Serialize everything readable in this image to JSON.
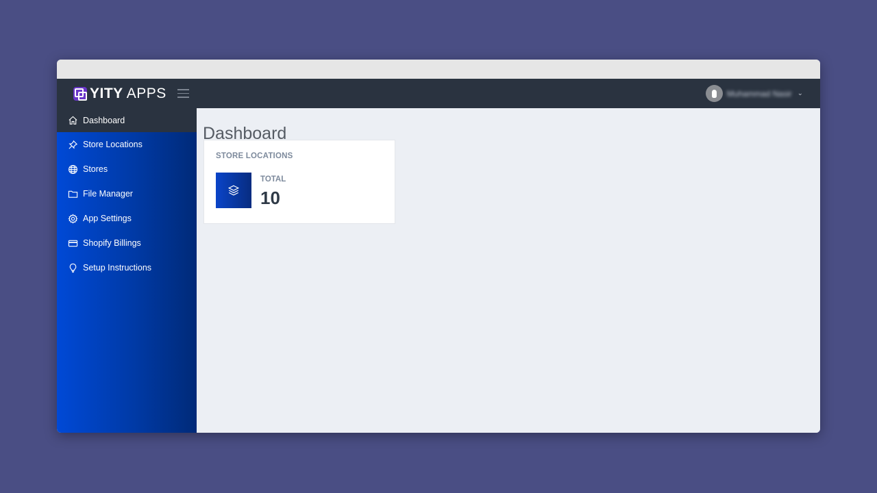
{
  "header": {
    "logo_bold": "YITY",
    "logo_light": "APPS",
    "user_name": "Muhammad Nasir"
  },
  "sidebar": {
    "items": [
      {
        "label": "Dashboard",
        "icon": "home-icon",
        "active": true
      },
      {
        "label": "Store Locations",
        "icon": "pin-icon"
      },
      {
        "label": "Stores",
        "icon": "globe-icon"
      },
      {
        "label": "File Manager",
        "icon": "folder-icon"
      },
      {
        "label": "App Settings",
        "icon": "gear-icon"
      },
      {
        "label": "Shopify Billings",
        "icon": "credit-card-icon"
      },
      {
        "label": "Setup Instructions",
        "icon": "lightbulb-icon"
      }
    ]
  },
  "main": {
    "title": "Dashboard",
    "card": {
      "title": "STORE LOCATIONS",
      "icon": "layers-icon",
      "stat_label": "TOTAL",
      "stat_value": "10"
    }
  }
}
